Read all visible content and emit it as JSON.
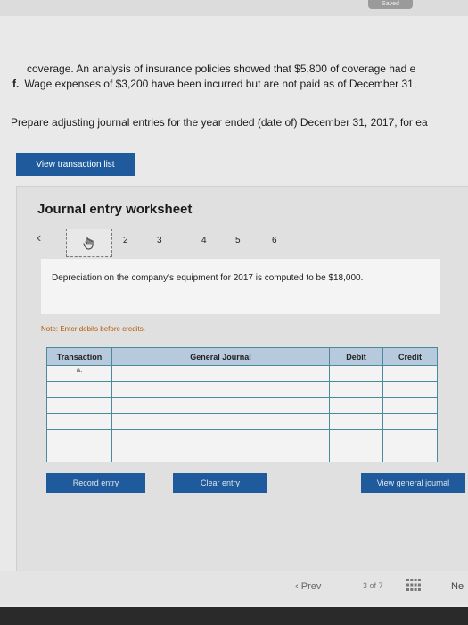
{
  "header": {
    "saved_label": "Saved"
  },
  "problem": {
    "line1": "coverage. An analysis of insurance policies showed that $5,800 of coverage had e",
    "line2_marker": "f.",
    "line2": "Wage expenses of $3,200 have been incurred but are not paid as of December 31,",
    "instruction": "Prepare adjusting journal entries for the year ended (date of) December 31, 2017, for ea"
  },
  "view_transaction_list_label": "View transaction list",
  "worksheet": {
    "title": "Journal entry worksheet",
    "tabs": [
      "2",
      "3",
      "4",
      "5",
      "6"
    ],
    "description": "Depreciation on the company's equipment for 2017 is computed to be $18,000.",
    "note": "Note: Enter debits before credits."
  },
  "table": {
    "headers": [
      "Transaction",
      "General Journal",
      "Debit",
      "Credit"
    ],
    "first_transaction": "a."
  },
  "buttons": {
    "record": "Record entry",
    "clear": "Clear entry",
    "view_journal": "View general journal"
  },
  "pager": {
    "prev": "Prev",
    "current": "3",
    "of": "of",
    "total": "7",
    "next": "Ne"
  },
  "colors": {
    "accent": "#1e5a9c",
    "table_header": "#b7c9dd",
    "note": "#b35a00"
  }
}
